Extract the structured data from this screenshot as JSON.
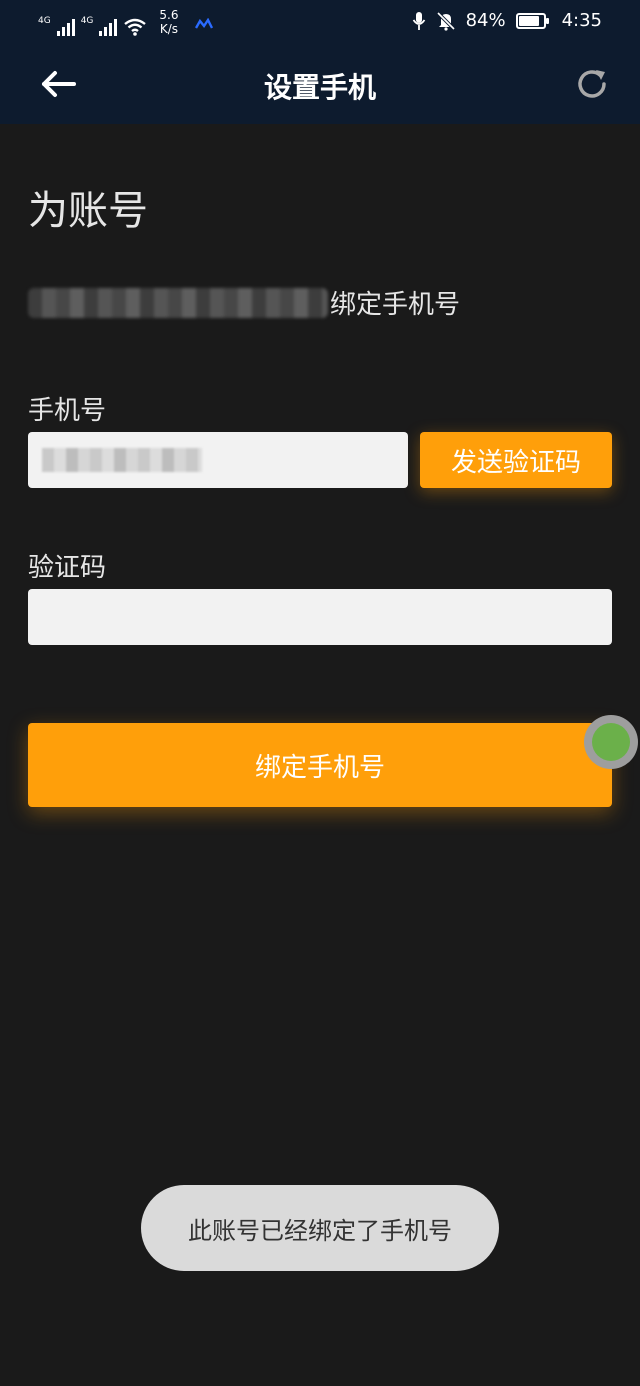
{
  "status_bar": {
    "network_1": "4G",
    "network_2": "4G",
    "speed_value": "5.6",
    "speed_unit": "K/s",
    "battery_percent": "84%",
    "battery_level": 0.84,
    "time": "4:35"
  },
  "header": {
    "title": "设置手机",
    "background_color": "#0d1b2e"
  },
  "form": {
    "heading": "为账号",
    "bind_suffix": "绑定手机号",
    "phone_label": "手机号",
    "phone_value_redacted": true,
    "send_code_label": "发送验证码",
    "code_label": "验证码",
    "code_value": "",
    "submit_label": "绑定手机号",
    "accent_color": "#ff9f0a"
  },
  "toast": {
    "message": "此账号已经绑定了手机号"
  },
  "icons": {
    "back": "back-arrow-icon",
    "refresh": "refresh-icon",
    "mic": "mic-icon",
    "mute": "bell-muted-icon",
    "wifi": "wifi-icon",
    "battery": "battery-icon"
  }
}
